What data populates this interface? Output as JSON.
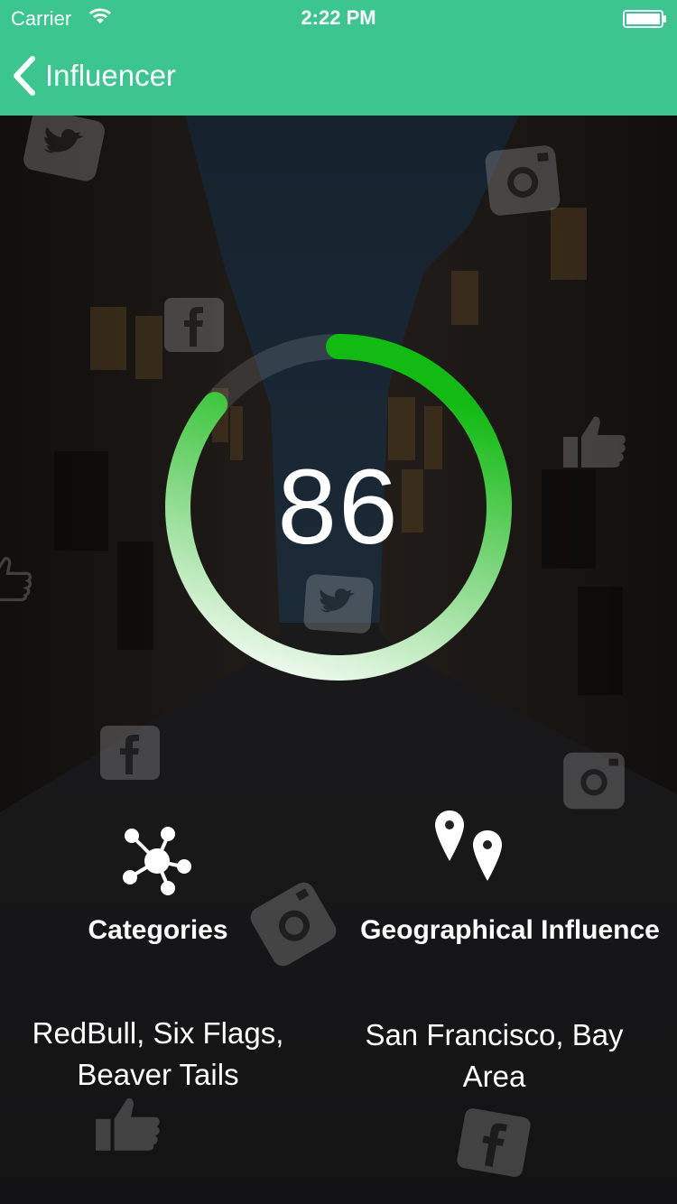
{
  "status_bar": {
    "carrier": "Carrier",
    "time": "2:22 PM"
  },
  "nav": {
    "title": "Influencer",
    "bar_color": "#3cc68f"
  },
  "score": {
    "value": "86",
    "progress": 0.86,
    "ring_start_color": "#ffffff",
    "ring_end_color": "#11bb11"
  },
  "categories": {
    "title": "Categories",
    "value": "RedBull, Six Flags, Beaver Tails",
    "icon": "network-nodes-icon"
  },
  "geo": {
    "title": "Geographical Influence",
    "value": "San Francisco, Bay Area",
    "icon": "map-pins-icon"
  }
}
